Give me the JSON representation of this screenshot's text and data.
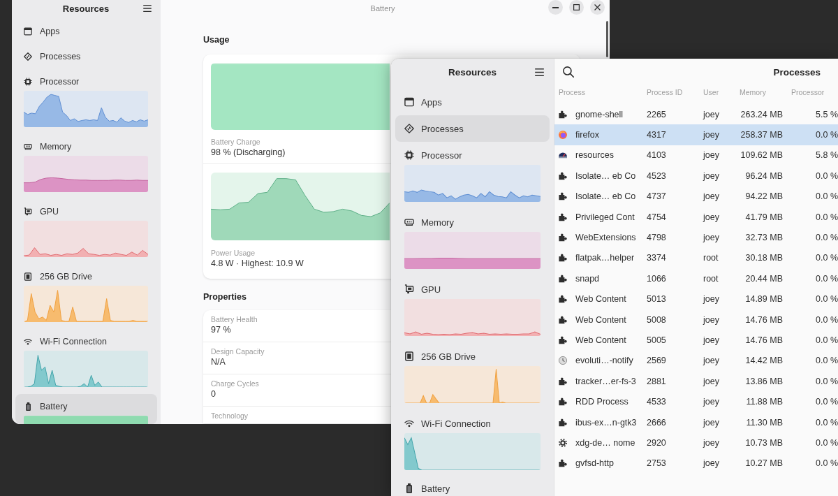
{
  "back_window": {
    "sidebar": {
      "title": "Resources",
      "items": [
        {
          "label": "Apps",
          "kind": "apps",
          "selected": false
        },
        {
          "label": "Processes",
          "kind": "processes",
          "selected": false
        },
        {
          "label": "Processor",
          "kind": "processor",
          "selected": false
        },
        {
          "label": "Memory",
          "kind": "memory",
          "selected": false
        },
        {
          "label": "GPU",
          "kind": "gpu",
          "selected": false
        },
        {
          "label": "256 GB Drive",
          "kind": "drive",
          "selected": false
        },
        {
          "label": "Wi-Fi Connection",
          "kind": "network",
          "selected": false
        },
        {
          "label": "Battery",
          "kind": "battery",
          "selected": true
        }
      ]
    },
    "header": {
      "subtitle": "Battery"
    },
    "usage": {
      "heading": "Usage",
      "charge": {
        "label": "Battery Charge",
        "value": "98 % (Discharging)"
      },
      "power": {
        "label": "Power Usage",
        "value": "4.8 W · Highest: 10.9 W"
      }
    },
    "properties": {
      "heading": "Properties",
      "rows": [
        {
          "label": "Battery Health",
          "value": "97 %"
        },
        {
          "label": "Design Capacity",
          "value": "N/A"
        },
        {
          "label": "Charge Cycles",
          "value": "0"
        },
        {
          "label": "Technology"
        }
      ]
    }
  },
  "front_window": {
    "sidebar": {
      "title": "Resources",
      "items": [
        {
          "label": "Apps",
          "kind": "apps",
          "selected": false
        },
        {
          "label": "Processes",
          "kind": "processes",
          "selected": true
        },
        {
          "label": "Processor",
          "kind": "processor",
          "selected": false
        },
        {
          "label": "Memory",
          "kind": "memory",
          "selected": false
        },
        {
          "label": "GPU",
          "kind": "gpu",
          "selected": false
        },
        {
          "label": "256 GB Drive",
          "kind": "drive",
          "selected": false
        },
        {
          "label": "Wi-Fi Connection",
          "kind": "network",
          "selected": false
        },
        {
          "label": "Battery",
          "kind": "battery",
          "selected": false
        }
      ]
    },
    "header": {
      "title": "Processes"
    },
    "table": {
      "columns": [
        "Process",
        "Process ID",
        "User",
        "Memory",
        "Processor"
      ],
      "rows": [
        {
          "kind": "puzzle",
          "selected": false,
          "cells": [
            "gnome-shell",
            "2265",
            "joey",
            "263.24 MB",
            "5.5 %"
          ]
        },
        {
          "kind": "browser",
          "selected": true,
          "cells": [
            "firefox",
            "4317",
            "joey",
            "258.37 MB",
            "0.0 %"
          ]
        },
        {
          "kind": "gauge",
          "selected": false,
          "cells": [
            "resources",
            "4103",
            "joey",
            "109.62 MB",
            "5.8 %"
          ]
        },
        {
          "kind": "puzzle",
          "selected": false,
          "cells": [
            "Isolate… eb Co",
            "4523",
            "joey",
            "96.24 MB",
            "0.0 %"
          ]
        },
        {
          "kind": "puzzle",
          "selected": false,
          "cells": [
            "Isolate… eb Co",
            "4737",
            "joey",
            "94.22 MB",
            "0.0 %"
          ]
        },
        {
          "kind": "puzzle",
          "selected": false,
          "cells": [
            "Privileged Cont",
            "4754",
            "joey",
            "41.79 MB",
            "0.0 %"
          ]
        },
        {
          "kind": "puzzle",
          "selected": false,
          "cells": [
            "WebExtensions",
            "4798",
            "joey",
            "32.73 MB",
            "0.0 %"
          ]
        },
        {
          "kind": "puzzle",
          "selected": false,
          "cells": [
            "flatpak…helper",
            "3374",
            "root",
            "30.18 MB",
            "0.0 %"
          ]
        },
        {
          "kind": "puzzle",
          "selected": false,
          "cells": [
            "snapd",
            "1066",
            "root",
            "20.44 MB",
            "0.0 %"
          ]
        },
        {
          "kind": "puzzle",
          "selected": false,
          "cells": [
            "Web Content",
            "5013",
            "joey",
            "14.89 MB",
            "0.0 %"
          ]
        },
        {
          "kind": "puzzle",
          "selected": false,
          "cells": [
            "Web Content",
            "5008",
            "joey",
            "14.76 MB",
            "0.0 %"
          ]
        },
        {
          "kind": "puzzle",
          "selected": false,
          "cells": [
            "Web Content",
            "5005",
            "joey",
            "14.76 MB",
            "0.0 %"
          ]
        },
        {
          "kind": "clock",
          "selected": false,
          "cells": [
            "evoluti…-notify",
            "2569",
            "joey",
            "14.42 MB",
            "0.0 %"
          ]
        },
        {
          "kind": "puzzle",
          "selected": false,
          "cells": [
            "tracker…er-fs-3",
            "2881",
            "joey",
            "13.86 MB",
            "0.0 %"
          ]
        },
        {
          "kind": "puzzle",
          "selected": false,
          "cells": [
            "RDD Process",
            "4533",
            "joey",
            "11.88 MB",
            "0.0 %"
          ]
        },
        {
          "kind": "puzzle",
          "selected": false,
          "cells": [
            "ibus-ex…n-gtk3",
            "2666",
            "joey",
            "11.30 MB",
            "0.0 %"
          ]
        },
        {
          "kind": "gear",
          "selected": false,
          "cells": [
            "xdg-de… nome",
            "2920",
            "joey",
            "10.73 MB",
            "0.0 %"
          ]
        },
        {
          "kind": "puzzle",
          "selected": false,
          "cells": [
            "gvfsd-http",
            "2753",
            "joey",
            "10.27 MB",
            "0.0 %"
          ]
        }
      ]
    }
  }
}
